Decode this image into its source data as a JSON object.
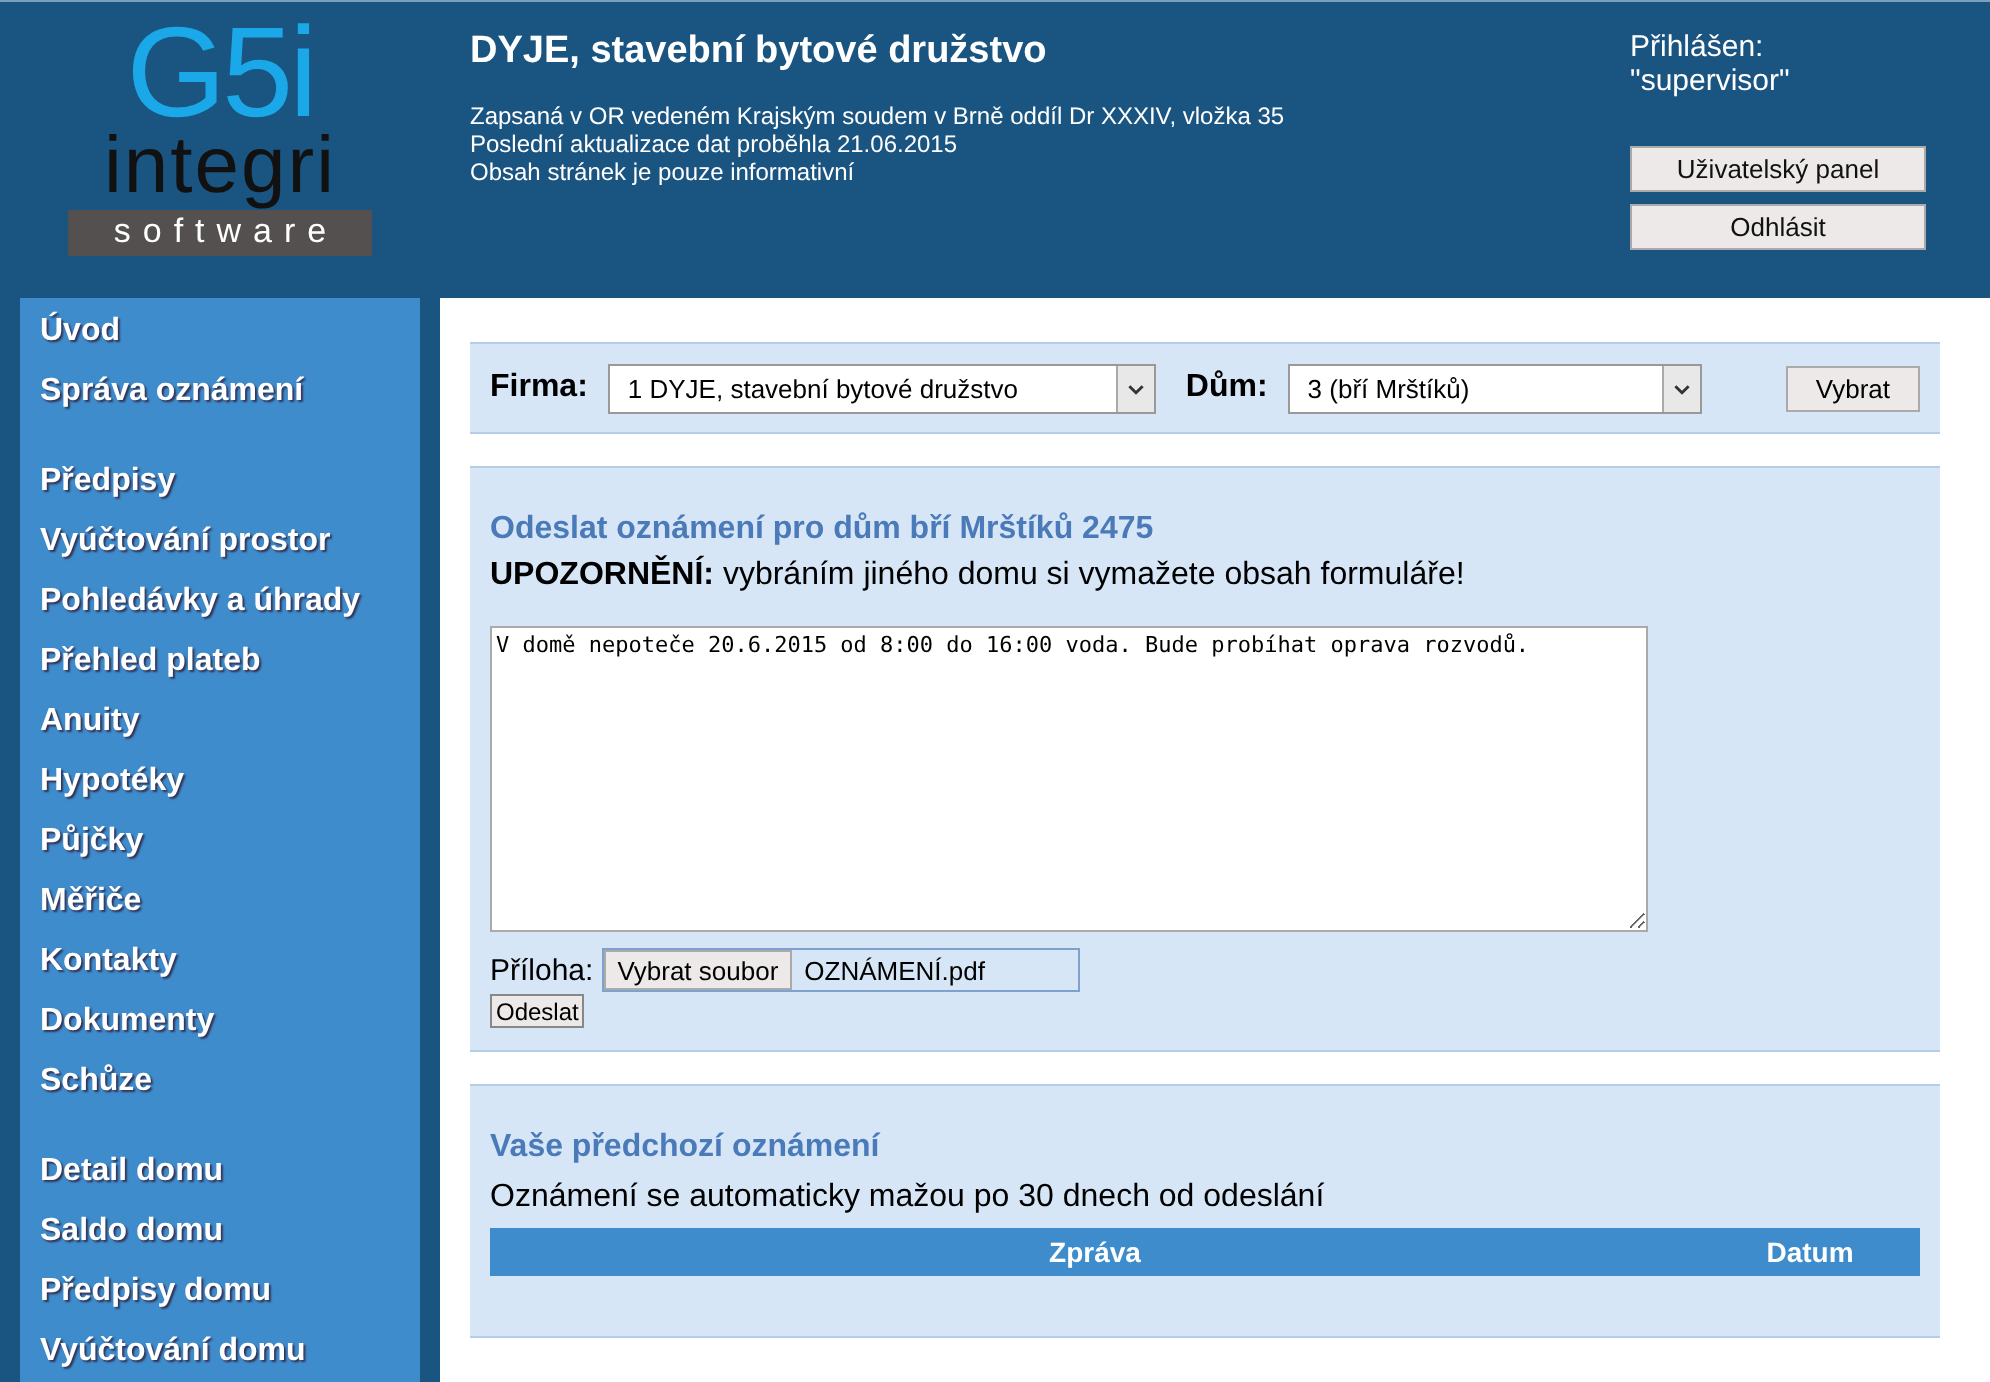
{
  "logo": {
    "mark": "G5i",
    "word": "integri",
    "tagline": "software"
  },
  "header": {
    "title": "DYJE, stavební bytové družstvo",
    "lines": [
      "Zapsaná v OR vedeném Krajským soudem v Brně oddíl Dr XXXIV, vložka 35",
      "Poslední aktualizace dat proběhla 21.06.2015",
      "Obsah stránek je pouze informativní"
    ],
    "login_label": "Přihlášen:",
    "login_user": "\"supervisor\"",
    "buttons": [
      "Uživatelský panel",
      "Odhlásit"
    ]
  },
  "sidebar": {
    "groups": [
      [
        "Úvod",
        "Správa oznámení"
      ],
      [
        "Předpisy",
        "Vyúčtování prostor",
        "Pohledávky a úhrady",
        "Přehled plateb",
        "Anuity",
        "Hypotéky",
        "Půjčky",
        "Měřiče",
        "Kontakty",
        "Dokumenty",
        "Schůze"
      ],
      [
        "Detail domu",
        "Saldo domu",
        "Předpisy domu",
        "Vyúčtování domu"
      ]
    ]
  },
  "filter": {
    "firm_label": "Firma:",
    "firm_value": "1 DYJE, stavební bytové družstvo",
    "house_label": "Dům:",
    "house_value": "3 (bří Mrštíků)",
    "button": "Vybrat"
  },
  "send_form": {
    "title": "Odeslat oznámení pro dům bří Mrštíků 2475",
    "warning": "**UPOZORNĚNÍ:** vybráním jiného domu si vymažete obsah formuláře!",
    "message": "V domě nepoteče 20.6.2015 od 8:00 do 16:00 voda. Bude probíhat oprava rozvodů.",
    "attachment_label": "Příloha:",
    "file_button": "Vybrat soubor",
    "file_name": "OZNÁMENÍ.pdf",
    "submit": "Odeslat"
  },
  "history": {
    "title": "Vaše předchozí oznámení",
    "note": "Oznámení se automaticky mažou po 30 dnech od odeslání",
    "columns": [
      "Zpráva",
      "Datum"
    ]
  }
}
